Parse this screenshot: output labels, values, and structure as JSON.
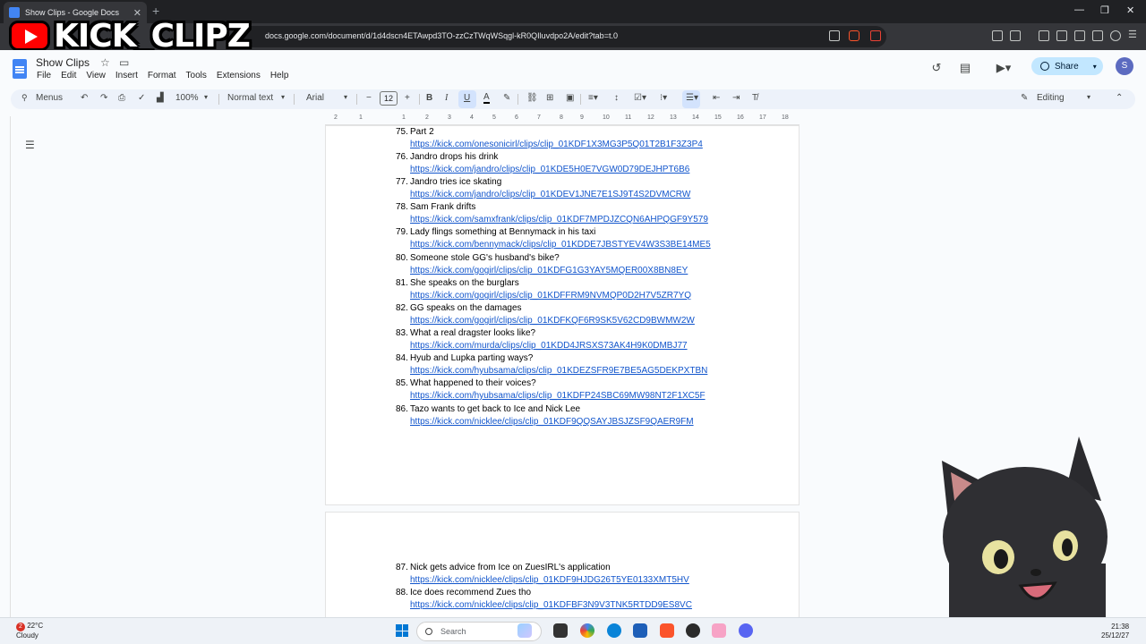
{
  "browser": {
    "tab_title": "Show Clips - Google Docs",
    "url": "docs.google.com/document/d/1d4dscn4ETAwpd3TO-zzCzTWqWSqgl-kR0QIluvdpo2A/edit?tab=t.0"
  },
  "overlay": {
    "logo_text": "KICK_CLIPZ"
  },
  "docs": {
    "title": "Show Clips",
    "menu": [
      "File",
      "Edit",
      "View",
      "Insert",
      "Format",
      "Tools",
      "Extensions",
      "Help"
    ],
    "share_label": "Share",
    "avatar_letter": "S"
  },
  "toolbar": {
    "search_label": "Menus",
    "zoom": "100%",
    "style": "Normal text",
    "font": "Arial",
    "font_size": "12",
    "mode": "Editing"
  },
  "ruler": [
    "2",
    "1",
    "1",
    "2",
    "3",
    "4",
    "5",
    "6",
    "7",
    "8",
    "9",
    "10",
    "11",
    "12",
    "13",
    "14",
    "15",
    "16",
    "17",
    "18"
  ],
  "entries": [
    {
      "num": "75.",
      "title": "Part 2",
      "link": "https://kick.com/onesonicirl/clips/clip_01KDF1X3MG3P5Q01T2B1F3Z3P4"
    },
    {
      "num": "76.",
      "title": "Jandro drops his drink",
      "link": "https://kick.com/jandro/clips/clip_01KDE5H0E7VGW0D79DEJHPT6B6"
    },
    {
      "num": "77.",
      "title": "Jandro tries ice skating",
      "link": "https://kick.com/jandro/clips/clip_01KDEV1JNE7E1SJ9T4S2DVMCRW"
    },
    {
      "num": "78.",
      "title": "Sam Frank drifts",
      "link": "https://kick.com/samxfrank/clips/clip_01KDF7MPDJZCQN6AHPQGF9Y579"
    },
    {
      "num": "79.",
      "title": "Lady flings something at Bennymack in his taxi",
      "link": "https://kick.com/bennymack/clips/clip_01KDDE7JBSTYEV4W3S3BE14ME5"
    },
    {
      "num": "80.",
      "title": "Someone stole GG's husband's bike?",
      "link": "https://kick.com/gogirl/clips/clip_01KDFG1G3YAY5MQER00X8BN8EY"
    },
    {
      "num": "81.",
      "title": "She speaks on the burglars",
      "link": "https://kick.com/gogirl/clips/clip_01KDFFRM9NVMQP0D2H7V5ZR7YQ"
    },
    {
      "num": "82.",
      "title": "GG speaks on the damages",
      "link": "https://kick.com/gogirl/clips/clip_01KDFKQF6R9SK5V62CD9BWMW2W"
    },
    {
      "num": "83.",
      "title": "What a real dragster looks like?",
      "link": "https://kick.com/murda/clips/clip_01KDD4JRSXS73AK4H9K0DMBJ77"
    },
    {
      "num": "84.",
      "title": "Hyub and Lupka parting ways?",
      "link": "https://kick.com/hyubsama/clips/clip_01KDEZSFR9E7BE5AG5DEKPXTBN"
    },
    {
      "num": "85.",
      "title": "What happened to their voices?",
      "link": "https://kick.com/hyubsama/clips/clip_01KDFP24SBC69MW98NT2F1XC5F"
    },
    {
      "num": "86.",
      "title": "Tazo wants to get back to Ice and Nick Lee",
      "link": "https://kick.com/nicklee/clips/clip_01KDF9QQSAYJBSJZSF9QAER9FM"
    },
    {
      "num": "87.",
      "title": "Nick gets advice from Ice on ZuesIRL's application",
      "link": "https://kick.com/nicklee/clips/clip_01KDF9HJDG26T5YE0133XMT5HV"
    },
    {
      "num": "88.",
      "title": "Ice does recommend Zues tho",
      "link": "https://kick.com/nicklee/clips/clip_01KDFBF3N9V3TNK5RTDD9ES8VC"
    }
  ],
  "taskbar": {
    "weather_badge": "2",
    "temperature": "22°C",
    "condition": "Cloudy",
    "search": "Search",
    "time": "21:38",
    "date": "25/12/27"
  }
}
